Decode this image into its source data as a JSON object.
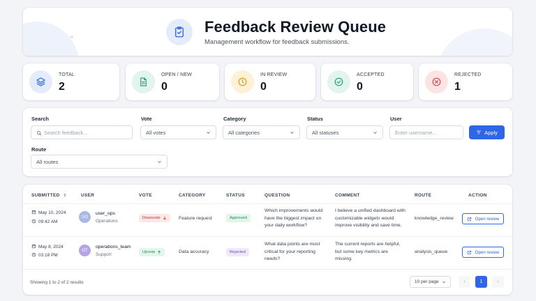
{
  "header": {
    "title": "Feedback Review Queue",
    "subtitle": "Management workflow for feedback submissions."
  },
  "stats": [
    {
      "label": "TOTAL",
      "value": "2",
      "icon": "layers-icon"
    },
    {
      "label": "OPEN / NEW",
      "value": "0",
      "icon": "document-icon"
    },
    {
      "label": "IN REVIEW",
      "value": "0",
      "icon": "clock-icon"
    },
    {
      "label": "ACCEPTED",
      "value": "0",
      "icon": "check-circle-icon"
    },
    {
      "label": "REJECTED",
      "value": "1",
      "icon": "x-circle-icon"
    }
  ],
  "filters": {
    "search_label": "Search",
    "search_placeholder": "Search feedback...",
    "vote_label": "Vote",
    "vote_value": "All votes",
    "category_label": "Category",
    "category_value": "All categories",
    "status_label": "Status",
    "status_value": "All statuses",
    "user_label": "User",
    "user_placeholder": "Enter username...",
    "apply_label": "Apply",
    "route_label": "Route",
    "route_value": "All routes"
  },
  "table": {
    "columns": [
      "SUBMITTED",
      "USER",
      "VOTE",
      "CATEGORY",
      "STATUS",
      "QUESTION",
      "COMMENT",
      "ROUTE",
      "ACTION"
    ],
    "rows": [
      {
        "date": "May 10, 2024",
        "time": "09:42 AM",
        "avatar": "UO",
        "user": "user_ops",
        "team": "Operations",
        "vote": "Downvote",
        "category": "Feature request",
        "status": "Approved",
        "question": [
          "Which improvements would",
          "have the biggest impact on",
          "your daily workflow?"
        ],
        "comment": [
          "I believe a unified dashboard with",
          "customizable widgets would",
          "improve visibility and save time."
        ],
        "route": "knowledge_review",
        "action": "Open review"
      },
      {
        "date": "May 8, 2024",
        "time": "03:18 PM",
        "avatar": "OT",
        "user": "operations_team",
        "team": "Support",
        "vote": "Upvote",
        "category": "Data accuracy",
        "status": "Rejected",
        "question": [
          "What data points are most",
          "critical for your reporting",
          "needs?"
        ],
        "comment": [
          "The current reports are helpful,",
          "but some key metrics are",
          "missing."
        ],
        "route": "analysis_queue",
        "action": "Open review"
      }
    ],
    "footer": "Showing 1 to 2 of 2 results",
    "per_page": "10 per page",
    "current_page": "1",
    "prev": "‹",
    "next": "›"
  },
  "colors": {
    "accent": "#2f66e8",
    "downvote_bg": "#fde8e8",
    "downvote_fg": "#c0392b",
    "upvote_bg": "#e3f6ea",
    "upvote_fg": "#23895a",
    "approved_bg": "#e3f6ea",
    "approved_fg": "#23895a",
    "rejected_bg": "#efe9fb",
    "rejected_fg": "#6b46c1"
  }
}
